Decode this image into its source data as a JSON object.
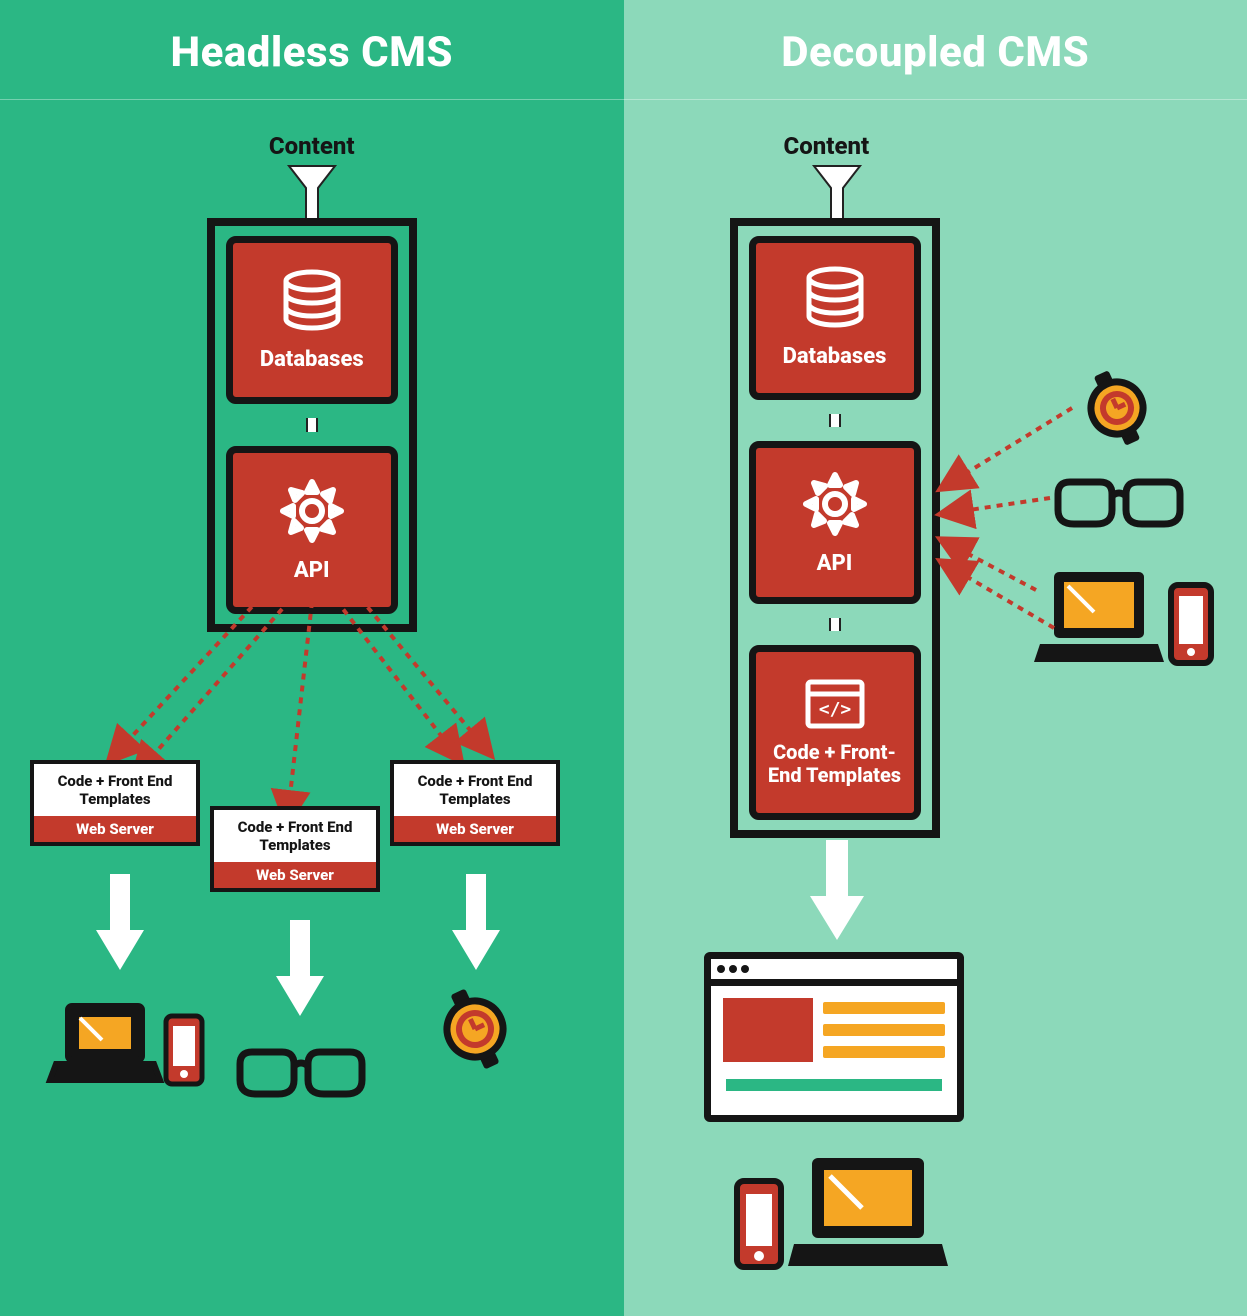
{
  "left": {
    "title": "Headless CMS",
    "content_label": "Content",
    "modules": {
      "db": "Databases",
      "api": "API"
    },
    "servers": {
      "a": {
        "top": "Code + Front End Templates",
        "bottom": "Web Server"
      },
      "b": {
        "top": "Code + Front End Templates",
        "bottom": "Web Server"
      },
      "c": {
        "top": "Code + Front End Templates",
        "bottom": "Web Server"
      }
    }
  },
  "right": {
    "title": "Decoupled CMS",
    "content_label": "Content",
    "modules": {
      "db": "Databases",
      "api": "API",
      "templates": "Code + Front-End Templates"
    }
  },
  "colors": {
    "accent_red": "#c33a2c",
    "accent_orange": "#f5a623",
    "bg_left": "#2bb784",
    "bg_right": "#8cd9ba",
    "dark": "#151515"
  }
}
